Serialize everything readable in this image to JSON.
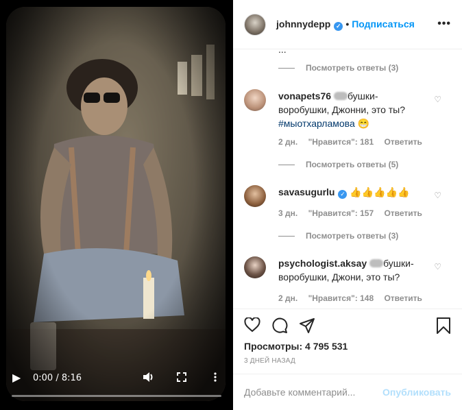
{
  "video": {
    "time": "0:00 / 8:16",
    "progress_fraction": 0.0
  },
  "header": {
    "username": "johnnydepp",
    "follow_label": "Подписаться",
    "separator": "•"
  },
  "comments": {
    "partial_text": "...",
    "view_replies": [
      "Посмотреть ответы (3)",
      "Посмотреть ответы (5)",
      "Посмотреть ответы (3)"
    ],
    "items": [
      {
        "username": "vonapets76",
        "text_line1": "бушки-",
        "text_line2": "воробушки, Джонни, это ты?",
        "hashtag": "#мыотхарламова",
        "emoji": "😁",
        "age": "2 дн.",
        "likes": "\"Нравится\": 181",
        "reply": "Ответить"
      },
      {
        "username": "savasugurlu",
        "text": "👍👍👍👍👍",
        "age": "3 дн.",
        "likes": "\"Нравится\": 157",
        "reply": "Ответить"
      },
      {
        "username": "psychologist.aksay",
        "text_line1": "бушки-",
        "text_line2": "воробушки, Джони, это ты?",
        "age": "2 дн.",
        "likes": "\"Нравится\": 148",
        "reply": "Ответить"
      }
    ]
  },
  "stats": {
    "views": "Просмотры: 4 795 531",
    "ago": "3 ДНЕЙ НАЗАД"
  },
  "composer": {
    "placeholder": "Добавьте комментарий...",
    "publish": "Опубликовать"
  },
  "icons": {
    "verified": "verified-badge-icon",
    "heart": "heart-icon",
    "comment": "comment-icon",
    "share": "share-icon",
    "bookmark": "bookmark-icon"
  },
  "colors": {
    "accent": "#0095f6",
    "verified": "#3897f0",
    "muted": "#8e8e8e",
    "publish_disabled": "#b2dffc"
  }
}
